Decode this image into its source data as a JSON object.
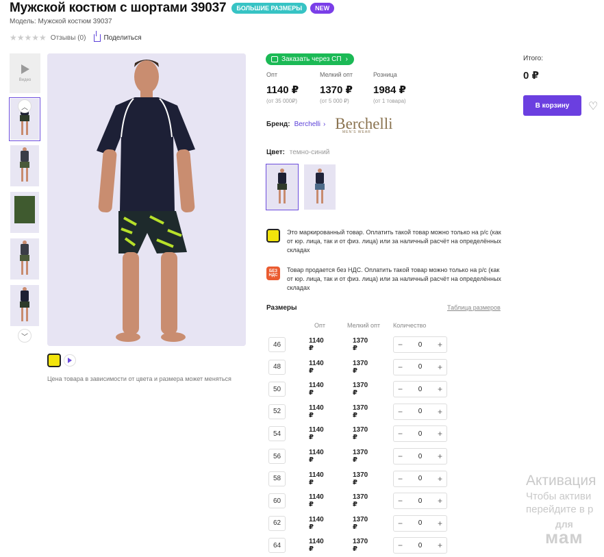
{
  "product": {
    "title": "Мужской костюм с шортами 39037",
    "badges": [
      "БОЛЬШИЕ РАЗМЕРЫ",
      "NEW"
    ],
    "model": "Модель: Мужской костюм 39037",
    "rating_stars": "★★★★★",
    "reviews": "Отзывы (0)",
    "share": "Поделиться"
  },
  "gallery": {
    "video_label": "Видео",
    "price_note": "Цена товара в зависимости от цвета и размера может меняться"
  },
  "order": {
    "sp_button": "Заказать через СП",
    "prices": [
      {
        "label": "Опт",
        "value": "1140 ₽",
        "sub": "(от 35 000₽)"
      },
      {
        "label": "Мелкий опт",
        "value": "1370 ₽",
        "sub": "(от 5 000 ₽)"
      },
      {
        "label": "Розница",
        "value": "1984 ₽",
        "sub": "(от 1 товара)"
      }
    ],
    "brand_label": "Бренд:",
    "brand_link": "Berchelli",
    "brand_logo": "Berchelli",
    "brand_tagline": "MEN'S WEAR",
    "color_label": "Цвет:",
    "color_value": "темно-синий",
    "notices": [
      {
        "icon": "marking-icon",
        "text": "Это маркированный товар. Оплатить такой товар можно только на р/с (как от юр. лица, так и от физ. лица) или за наличный расчёт на определённых складах"
      },
      {
        "icon": "no-vat-icon",
        "icon_text": "БЕЗ НДС",
        "text": "Товар продается без НДС. Оплатить такой товар можно только на р/с (как от юр. лица, так и от физ. лица) или за наличный расчёт на определённых складах"
      }
    ],
    "sizes_title": "Размеры",
    "size_table_link": "Таблица размеров",
    "columns": [
      "Опт",
      "Мелкий опт",
      "Количество"
    ],
    "sizes": [
      {
        "size": "46",
        "opt": "1140 ₽",
        "small": "1370 ₽",
        "qty": "0"
      },
      {
        "size": "48",
        "opt": "1140 ₽",
        "small": "1370 ₽",
        "qty": "0"
      },
      {
        "size": "50",
        "opt": "1140 ₽",
        "small": "1370 ₽",
        "qty": "0"
      },
      {
        "size": "52",
        "opt": "1140 ₽",
        "small": "1370 ₽",
        "qty": "0"
      },
      {
        "size": "54",
        "opt": "1140 ₽",
        "small": "1370 ₽",
        "qty": "0"
      },
      {
        "size": "56",
        "opt": "1140 ₽",
        "small": "1370 ₽",
        "qty": "0"
      },
      {
        "size": "58",
        "opt": "1140 ₽",
        "small": "1370 ₽",
        "qty": "0"
      },
      {
        "size": "60",
        "opt": "1140 ₽",
        "small": "1370 ₽",
        "qty": "0"
      },
      {
        "size": "62",
        "opt": "1140 ₽",
        "small": "1370 ₽",
        "qty": "0"
      },
      {
        "size": "64",
        "opt": "1140 ₽",
        "small": "1370 ₽",
        "qty": "0"
      }
    ]
  },
  "summary": {
    "total_label": "Итого:",
    "total_value": "0 ₽",
    "cart_button": "В корзину"
  },
  "watermark": {
    "title": "Активация",
    "line1": "Чтобы активи",
    "line2": "перейдите в р",
    "logo_top": "для",
    "logo_bottom": "мам"
  },
  "colors": {
    "accent": "#6b3fe0",
    "sp_green": "#1bb955",
    "badge_teal": "#37c3c4",
    "badge_purple": "#7a3ee8"
  }
}
